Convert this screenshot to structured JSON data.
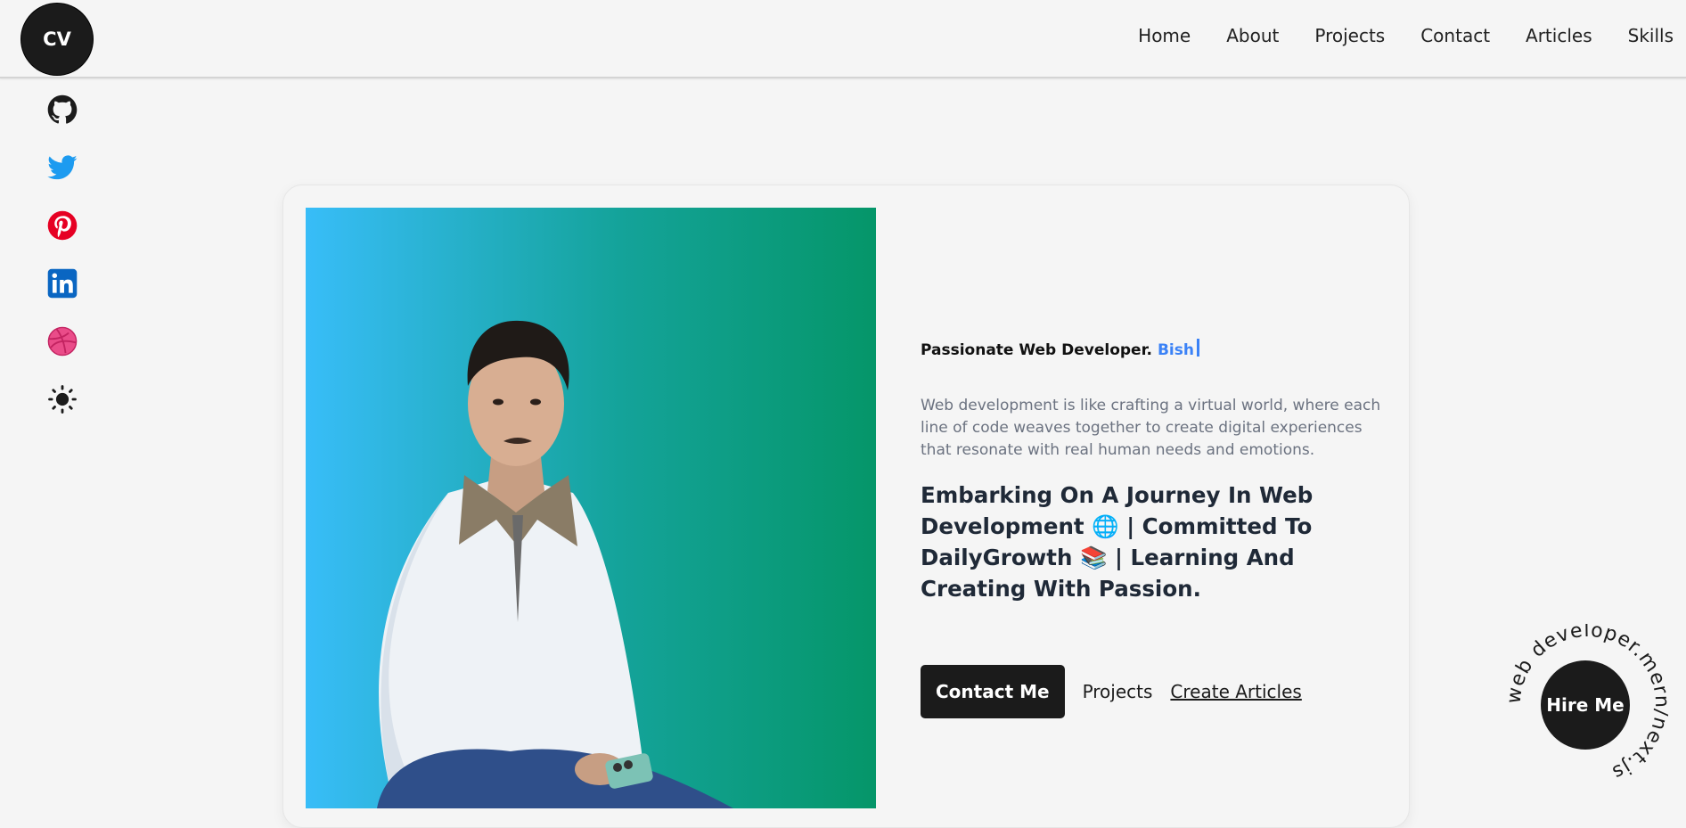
{
  "header": {
    "logo": "CV",
    "nav": [
      "Home",
      "About",
      "Projects",
      "Contact",
      "Articles",
      "Skills"
    ]
  },
  "social": [
    {
      "icon": "github-icon",
      "color": "#1b1b1b"
    },
    {
      "icon": "twitter-icon",
      "color": "#1d9bf0"
    },
    {
      "icon": "pinterest-icon",
      "color": "#e60023"
    },
    {
      "icon": "linkedin-icon",
      "color": "#0a66c2"
    },
    {
      "icon": "dribbble-icon",
      "color": "#ea4c89"
    },
    {
      "icon": "sun-icon",
      "color": "#1b1b1b"
    }
  ],
  "hero": {
    "tagline": "Passionate Web Developer.",
    "typed_name": "Bish",
    "description": "Web development is like crafting a virtual world, where each line of code weaves together to create digital experiences that resonate with real human needs and emotions.",
    "headline": {
      "part1": "Embarking On A Journey In Web Development",
      "emoji1": "🌐",
      "part2": "| Committed To DailyGrowth",
      "emoji2": "📚",
      "part3": "| Learning And Creating With Passion."
    },
    "buttons": {
      "contact": "Contact Me",
      "projects": "Projects",
      "articles": "Create Articles"
    }
  },
  "hire": {
    "label": "Hire Me",
    "circular_text": "web developer.mern/next.js"
  },
  "colors": {
    "accent": "#3b82f6",
    "dark": "#1b1b1b",
    "photo_gradient": [
      "#38bdf8",
      "#059669"
    ]
  }
}
